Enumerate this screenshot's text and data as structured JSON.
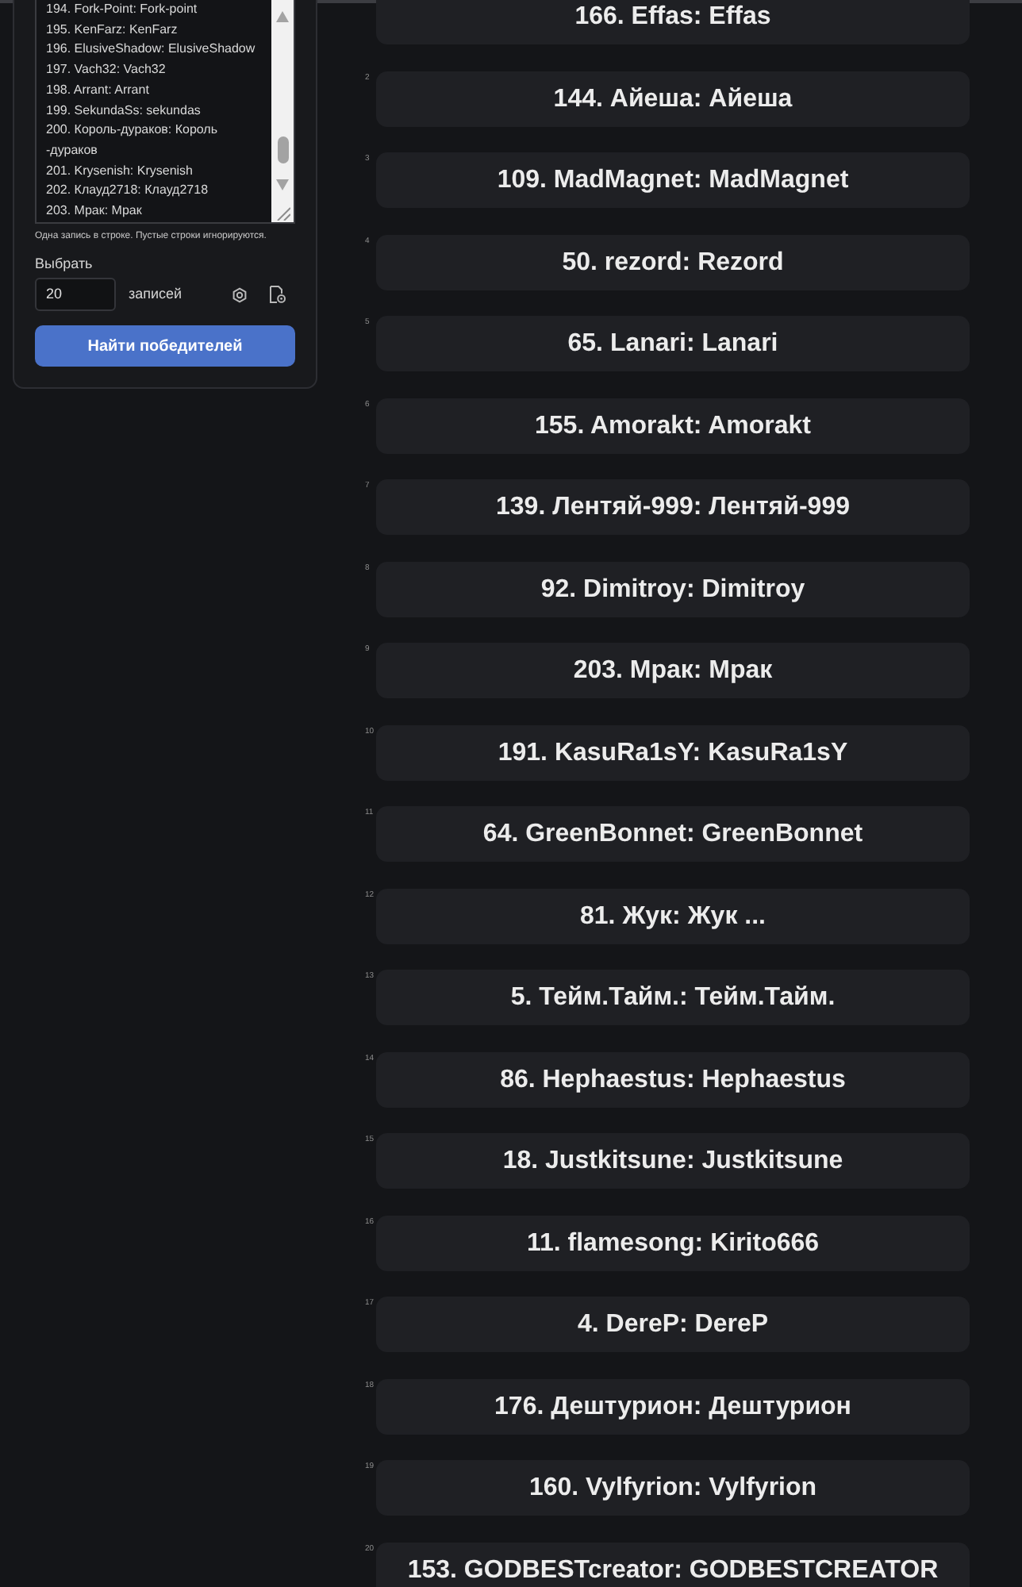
{
  "entries_field": {
    "lines": [
      "194. Fork-Point: Fork-point",
      "195. KenFarz: KenFarz",
      "196. ElusiveShadow: ElusiveShadow",
      "197. Vach32: Vach32",
      "198. Arrant: Arrant",
      "199. SekundaSs: sekundas",
      "200. Король-дураков: Король",
      "-дураков",
      "201. Krysenish: Krysenish",
      "202. Клауд2718: Клауд2718",
      "203. Мрак: Мрак"
    ]
  },
  "hint": "Одна запись в строке. Пустые строки игнорируются.",
  "pick": {
    "label": "Выбрать",
    "value": "20",
    "unit": "записей"
  },
  "find_button": {
    "label": "Найти победителей"
  },
  "winners": [
    {
      "text": "166. Effas: Effas"
    },
    {
      "index": "2",
      "text": "144. Айеша: Айеша"
    },
    {
      "index": "3",
      "text": "109. MadMagnet: MadMagnet"
    },
    {
      "index": "4",
      "text": "50. rezord: Rezord"
    },
    {
      "index": "5",
      "text": "65. Lanari: Lanari"
    },
    {
      "index": "6",
      "text": "155. Amorakt: Amorakt"
    },
    {
      "index": "7",
      "text": "139. Лентяй-999: Лентяй-999"
    },
    {
      "index": "8",
      "text": "92. Dimitroy: Dimitroy"
    },
    {
      "index": "9",
      "text": "203. Мрак: Мрак"
    },
    {
      "index": "10",
      "text": "191. KasuRa1sY: KasuRa1sY"
    },
    {
      "index": "11",
      "text": "64. GreenBonnet: GreenBonnet"
    },
    {
      "index": "12",
      "text": "81. Жук: Жук ..."
    },
    {
      "index": "13",
      "text": "5. Тейм.Тайм.: Тейм.Тайм."
    },
    {
      "index": "14",
      "text": "86. Hephaestus: Hephaestus"
    },
    {
      "index": "15",
      "text": "18. Justkitsune: Justkitsune"
    },
    {
      "index": "16",
      "text": "11. flamesong: Kirito666"
    },
    {
      "index": "17",
      "text": "4. DereP: DereP"
    },
    {
      "index": "18",
      "text": "176. Дештурион: Дештурион"
    },
    {
      "index": "19",
      "text": "160. Vylfyrion: Vylfyrion"
    },
    {
      "index": "20",
      "text": "153. GODBESTcreator: GODBESTCREATOR"
    }
  ]
}
